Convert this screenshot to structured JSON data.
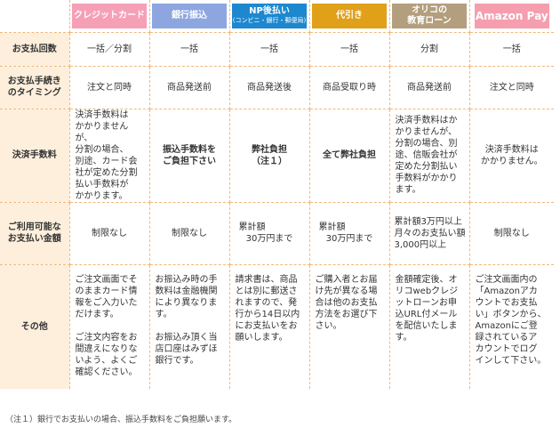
{
  "headers": {
    "credit": "クレジットカード",
    "bank": "銀行振込",
    "np_title": "NP後払い",
    "np_sub": "(コンビニ・銀行・郵便局)",
    "cod": "代引き",
    "orico_1": "オリコの",
    "orico_2": "教育ローン",
    "amazon": "Amazon Pay"
  },
  "rows": {
    "count": {
      "label": "お支払回数",
      "credit": "一括／分割",
      "bank": "一括",
      "np": "一括",
      "cod": "一括",
      "orico": "分割",
      "amazon": "一括"
    },
    "timing": {
      "label_1": "お支払手続き",
      "label_2": "のタイミング",
      "credit": "注文と同時",
      "bank": "商品発送前",
      "np": "商品発送後",
      "cod": "商品受取り時",
      "orico": "商品発送前",
      "amazon": "注文と同時"
    },
    "fee": {
      "label": "決済手数料",
      "credit": "決済手数料は\nかかりませんが、\n分割の場合、\n別途、カード会\n社が定めた分割\n払い手数料が\nかかります。",
      "bank_1": "振込手数料を",
      "bank_2": "ご負担下さい",
      "np_1": "弊社負担",
      "np_2": "（注１）",
      "cod": "全て弊社負担",
      "orico": "決済手数料はか\nかりませんが、\n分割の場合、別\n途、信販会社が\n定めた分割払い\n手数料がかかり\nます。",
      "amazon_1": "決済手数料は",
      "amazon_2": "かかりません。"
    },
    "limit": {
      "label_1": "ご利用可能な",
      "label_2": "お支払い金額",
      "credit": "制限なし",
      "bank": "制限なし",
      "np_1": "累計額",
      "np_2": "30万円まで",
      "cod_1": "累計額",
      "cod_2": "30万円まで",
      "orico_1": "累計額3万円以上",
      "orico_2": "月々のお支払い額",
      "orico_3": "3,000円以上",
      "amazon": "制限なし"
    },
    "other": {
      "label": "その他",
      "credit": "ご注文画面でそ\nのままカード情\n報をご入力いた\nだけます。\n\nご注文内容をお\n間違えになりな\nいよう、よくご\n確認ください。",
      "bank": "お振込み時の手\n数料は金融機関\nにより異なりま\nす。\n\nお振込み頂く当\n店口座はみずほ\n銀行です。",
      "np": "請求書は、商品\nとは別に郵送さ\nれますので、発\n行から14日以内\nにお支払いをお\n願いします。",
      "cod": "ご購入者とお届\nけ先が異なる場\n合は他のお支払\n方法をお選び下\nさい。",
      "orico": "金額確定後、オ\nリコwebクレジ\nットローンお申\n込URL付メール\nを配信いたしま\nす。",
      "amazon": "ご注文画面内の\n「Amazonアカ\nウントでお支払\nい」ボタンから、\nAmazonにご登\n録されているア\nカウントでログ\nインして下さい。"
    }
  },
  "note": "（注１）銀行でお支払いの場合、振込手数料をご負担願います。"
}
